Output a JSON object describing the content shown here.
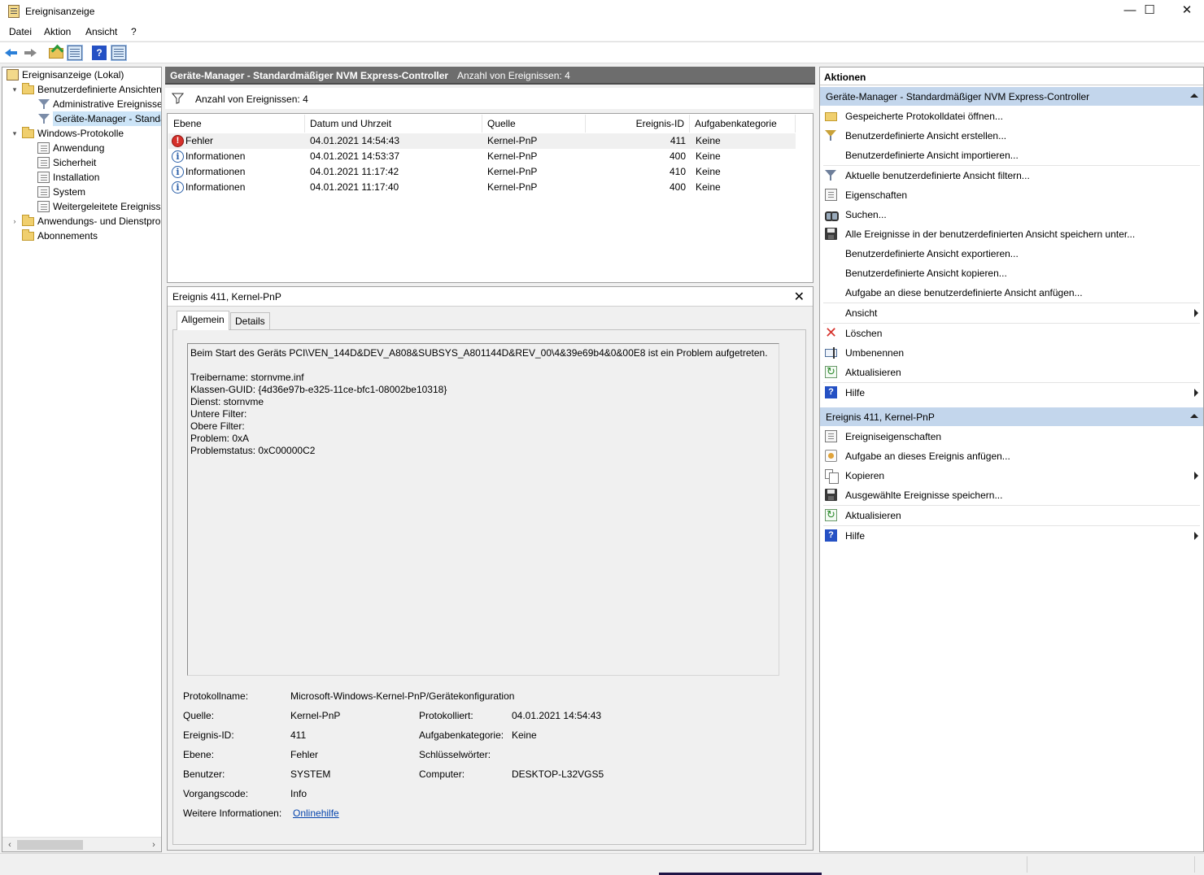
{
  "window": {
    "title": "Ereignisanzeige",
    "app_icon": "event-viewer-icon",
    "controls": [
      "—",
      "☐",
      "✕"
    ]
  },
  "menu": [
    "Datei",
    "Aktion",
    "Ansicht",
    "?"
  ],
  "toolbar": [
    "back-icon",
    "forward-icon",
    "up-folder-icon",
    "show-hide-tree-icon",
    "help-icon",
    "show-hide-action-pane-icon"
  ],
  "tree": {
    "root": "Ereignisanzeige (Lokal)",
    "custom_views": "Benutzerdefinierte Ansichten",
    "admin_events": "Administrative Ereignisse",
    "device_manager": "Geräte-Manager - Standa",
    "windows_logs": "Windows-Protokolle",
    "application": "Anwendung",
    "security": "Sicherheit",
    "setup": "Installation",
    "system": "System",
    "forwarded": "Weitergeleitete Ereignisse",
    "app_services": "Anwendungs- und Dienstpro",
    "subscriptions": "Abonnements"
  },
  "center": {
    "title": "Geräte-Manager - Standardmäßiger NVM Express-Controller",
    "count": "Anzahl von Ereignissen: 4",
    "filter_text": "Anzahl von Ereignissen: 4",
    "columns": {
      "level": "Ebene",
      "date": "Datum und Uhrzeit",
      "source": "Quelle",
      "event_id": "Ereignis-ID",
      "category": "Aufgabenkategorie"
    },
    "rows": [
      {
        "icon": "error-icon",
        "level": "Fehler",
        "date": "04.01.2021 14:54:43",
        "source": "Kernel-PnP",
        "event_id": "411",
        "category": "Keine"
      },
      {
        "icon": "info-icon",
        "level": "Informationen",
        "date": "04.01.2021 14:53:37",
        "source": "Kernel-PnP",
        "event_id": "400",
        "category": "Keine"
      },
      {
        "icon": "info-icon",
        "level": "Informationen",
        "date": "04.01.2021 11:17:42",
        "source": "Kernel-PnP",
        "event_id": "410",
        "category": "Keine"
      },
      {
        "icon": "info-icon",
        "level": "Informationen",
        "date": "04.01.2021 11:17:40",
        "source": "Kernel-PnP",
        "event_id": "400",
        "category": "Keine"
      }
    ]
  },
  "detail": {
    "title": "Ereignis 411, Kernel-PnP",
    "close": "✕",
    "tabs": {
      "general": "Allgemein",
      "details": "Details"
    },
    "description": "Beim Start des Geräts PCI\\VEN_144D&DEV_A808&SUBSYS_A801144D&REV_00\\4&39e69b4&0&00E8 ist ein Problem aufgetreten.\n\nTreibername: stornvme.inf\nKlassen-GUID: {4d36e97b-e325-11ce-bfc1-08002be10318}\nDienst: stornvme\nUntere Filter:\nObere Filter:\nProblem: 0xA\nProblemstatus: 0xC00000C2",
    "fields": {
      "log_name_label": "Protokollname:",
      "log_name": "Microsoft-Windows-Kernel-PnP/Gerätekonfiguration",
      "source_label": "Quelle:",
      "source": "Kernel-PnP",
      "logged_label": "Protokolliert:",
      "logged": "04.01.2021 14:54:43",
      "event_id_label": "Ereignis-ID:",
      "event_id": "411",
      "category_label": "Aufgabenkategorie:",
      "category": "Keine",
      "level_label": "Ebene:",
      "level": "Fehler",
      "keywords_label": "Schlüsselwörter:",
      "user_label": "Benutzer:",
      "user": "SYSTEM",
      "computer_label": "Computer:",
      "computer": "DESKTOP-L32VGS5",
      "opcode_label": "Vorgangscode:",
      "opcode": "Info",
      "more_info_label": "Weitere Informationen:",
      "more_info_link": "Onlinehilfe"
    }
  },
  "actions": {
    "title": "Aktionen",
    "section1": "Geräte-Manager - Standardmäßiger NVM Express-Controller",
    "items1": [
      {
        "icon": "open-folder-icon",
        "label": "Gespeicherte Protokolldatei öffnen..."
      },
      {
        "icon": "create-view-icon",
        "label": "Benutzerdefinierte Ansicht erstellen..."
      },
      {
        "icon": "",
        "label": "Benutzerdefinierte Ansicht importieren..."
      },
      {
        "icon": "filter-icon",
        "label": "Aktuelle benutzerdefinierte Ansicht filtern..."
      },
      {
        "icon": "properties-icon",
        "label": "Eigenschaften"
      },
      {
        "icon": "find-icon",
        "label": "Suchen..."
      },
      {
        "icon": "save-icon",
        "label": "Alle Ereignisse in der benutzerdefinierten Ansicht speichern unter..."
      },
      {
        "icon": "",
        "label": "Benutzerdefinierte Ansicht exportieren..."
      },
      {
        "icon": "",
        "label": "Benutzerdefinierte Ansicht kopieren..."
      },
      {
        "icon": "",
        "label": "Aufgabe an diese benutzerdefinierte Ansicht anfügen..."
      },
      {
        "icon": "",
        "label": "Ansicht"
      },
      {
        "icon": "delete-icon",
        "label": "Löschen"
      },
      {
        "icon": "rename-icon",
        "label": "Umbenennen"
      },
      {
        "icon": "refresh-icon",
        "label": "Aktualisieren"
      },
      {
        "icon": "help-icon",
        "label": "Hilfe"
      }
    ],
    "section2": "Ereignis 411, Kernel-PnP",
    "items2": [
      {
        "icon": "event-properties-icon",
        "label": "Ereigniseigenschaften"
      },
      {
        "icon": "attach-task-icon",
        "label": "Aufgabe an dieses Ereignis anfügen..."
      },
      {
        "icon": "copy-icon",
        "label": "Kopieren"
      },
      {
        "icon": "save-icon",
        "label": "Ausgewählte Ereignisse speichern..."
      },
      {
        "icon": "refresh-icon",
        "label": "Aktualisieren"
      },
      {
        "icon": "help-icon",
        "label": "Hilfe"
      }
    ]
  }
}
